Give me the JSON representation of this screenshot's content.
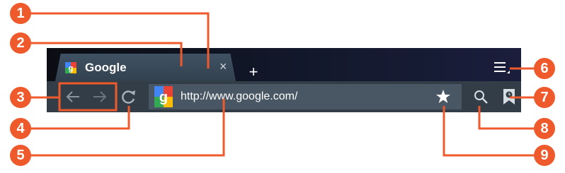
{
  "tab": {
    "title": "Google",
    "close_symbol": "×"
  },
  "new_tab": {
    "symbol": "+"
  },
  "urlbar": {
    "url": "http://www.google.com/"
  },
  "callouts": [
    "1",
    "2",
    "3",
    "4",
    "5",
    "6",
    "7",
    "8",
    "9"
  ],
  "icons": {
    "favicon": "google-favicon-icon",
    "back": "back-arrow-icon",
    "forward": "forward-arrow-icon",
    "reload": "reload-icon",
    "bookmark_star": "star-icon",
    "search": "search-icon",
    "bookmarks": "bookmarks-icon",
    "menu": "menu-icon"
  },
  "colors": {
    "callout": "#ee5a2b",
    "toolbar": "#333d48",
    "urlbar": "#495663",
    "tab": "#3a4a58"
  }
}
